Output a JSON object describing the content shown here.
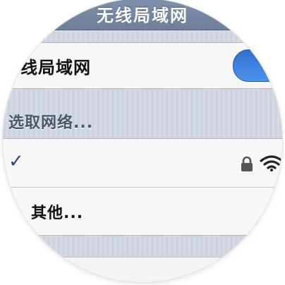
{
  "navbar": {
    "title": "无线局域网"
  },
  "wifi_toggle_row": {
    "label": "无线局域网",
    "toggle_on": true,
    "accent_color": "#3a7fe0"
  },
  "networks": {
    "header": "选取网络...",
    "items": [
      {
        "check_glyph": "✓",
        "icons": [
          "lock-icon",
          "wifi-signal-icon"
        ]
      }
    ],
    "other_label": "其他..."
  },
  "colors": {
    "navbar": "#7386a2",
    "section_background": "#d0d6e1",
    "cell_background": "#f7f7f7"
  }
}
